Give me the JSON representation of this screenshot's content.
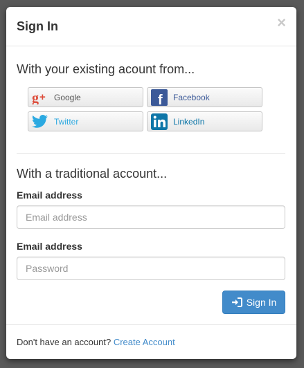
{
  "modal": {
    "title": "Sign In",
    "close_label": "×"
  },
  "social": {
    "heading": "With your existing acount from...",
    "buttons": [
      {
        "label": "Google",
        "icon": "google-plus-icon",
        "text_color": "#555555",
        "icon_color": "#dd4b39"
      },
      {
        "label": "Facebook",
        "icon": "facebook-icon",
        "text_color": "#3b5998",
        "icon_color": "#3b5998"
      },
      {
        "label": "Twitter",
        "icon": "twitter-icon",
        "text_color": "#2ba9e1",
        "icon_color": "#2ba9e1"
      },
      {
        "label": "LinkedIn",
        "icon": "linkedin-icon",
        "text_color": "#0e76a8",
        "icon_color": "#0e76a8"
      },
      {
        "label": "",
        "icon": "aol-icon"
      },
      {
        "label": "",
        "icon": "yahoo-icon",
        "icon_color": "#720e9e"
      }
    ]
  },
  "traditional": {
    "heading": "With a traditional account...",
    "email_label": "Email address",
    "email_placeholder": "Email address",
    "password_label": "Email address",
    "password_placeholder": "Password",
    "signin_label": "Sign In"
  },
  "footer": {
    "text": "Don't have an account?",
    "link": "Create Account"
  },
  "colors": {
    "primary": "#428bca",
    "overlay": "#595959"
  }
}
